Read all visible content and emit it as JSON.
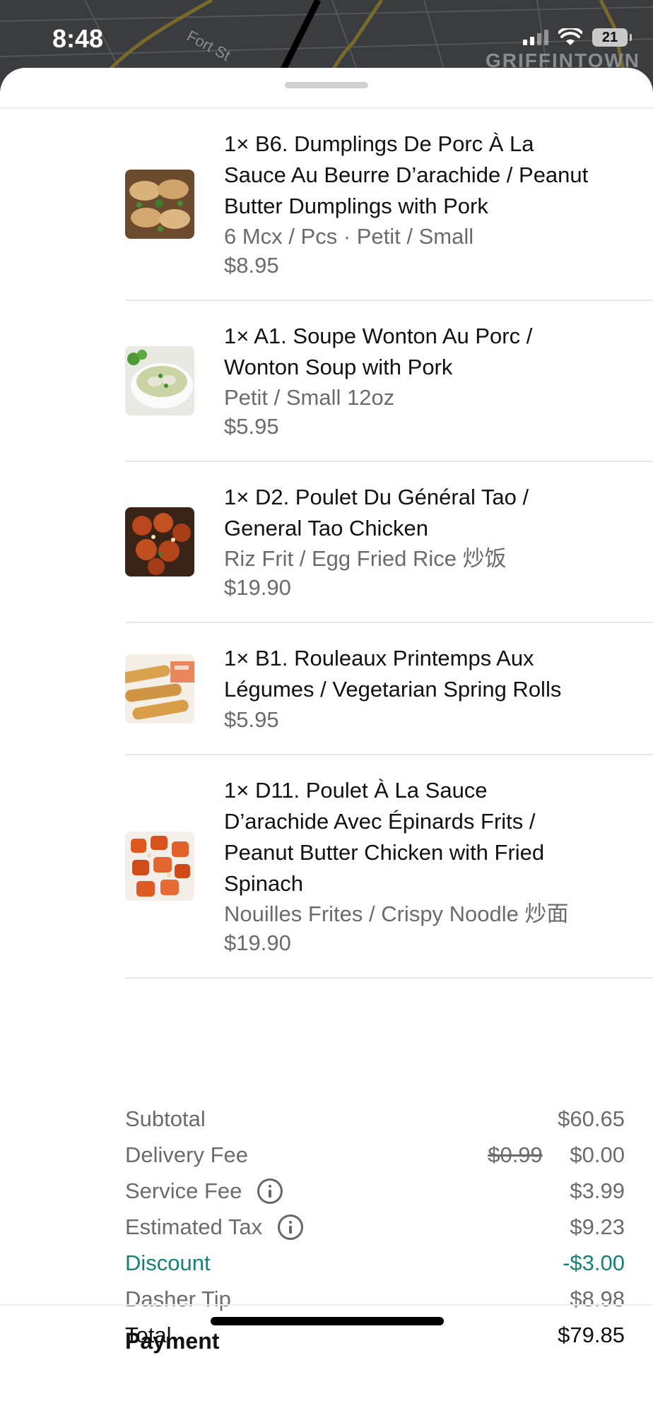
{
  "status_bar": {
    "time": "8:48",
    "battery": "21"
  },
  "map": {
    "street_label": "Fort St",
    "area_label": "GRIFFINTOWN"
  },
  "items": [
    {
      "name": "1× B6. Dumplings De Porc À La Sauce Au Beurre D’arachide / Peanut Butter Dumplings with Pork",
      "options": [
        "6 Mcx / Pcs · Petit / Small"
      ],
      "price": "$8.95",
      "image": "dumplings-image"
    },
    {
      "name": "1× A1. Soupe Wonton Au Porc / Wonton Soup with Pork",
      "options": [
        "Petit / Small 12oz"
      ],
      "price": "$5.95",
      "image": "wonton-soup-image"
    },
    {
      "name": "1× D2. Poulet Du Général Tao / General Tao Chicken",
      "options": [
        "Riz Frit / Egg Fried Rice 炒饭"
      ],
      "price": "$19.90",
      "image": "general-tao-chicken-image"
    },
    {
      "name": "1× B1. Rouleaux Printemps Aux Légumes / Vegetarian Spring Rolls",
      "options": [],
      "price": "$5.95",
      "image": "spring-rolls-image"
    },
    {
      "name": "1× D11. Poulet À La Sauce D’arachide Avec Épinards Frits / Peanut Butter Chicken with Fried Spinach",
      "options": [
        "Nouilles Frites / Crispy Noodle 炒面"
      ],
      "price": "$19.90",
      "image": "peanut-chicken-image"
    }
  ],
  "summary": {
    "subtotal": {
      "label": "Subtotal",
      "value": "$60.65"
    },
    "delivery_fee": {
      "label": "Delivery Fee",
      "original": "$0.99",
      "value": "$0.00"
    },
    "service_fee": {
      "label": "Service Fee",
      "value": "$3.99"
    },
    "estimated_tax": {
      "label": "Estimated Tax",
      "value": "$9.23"
    },
    "discount": {
      "label": "Discount",
      "value": "-$3.00"
    },
    "dasher_tip": {
      "label": "Dasher Tip",
      "value": "$8.98"
    },
    "total": {
      "label": "Total",
      "value": "$79.85"
    }
  },
  "payment": {
    "heading": "Payment"
  },
  "colors": {
    "discount": "#16817a",
    "sheet": "#ffffff",
    "map": "#3b3c3f"
  }
}
